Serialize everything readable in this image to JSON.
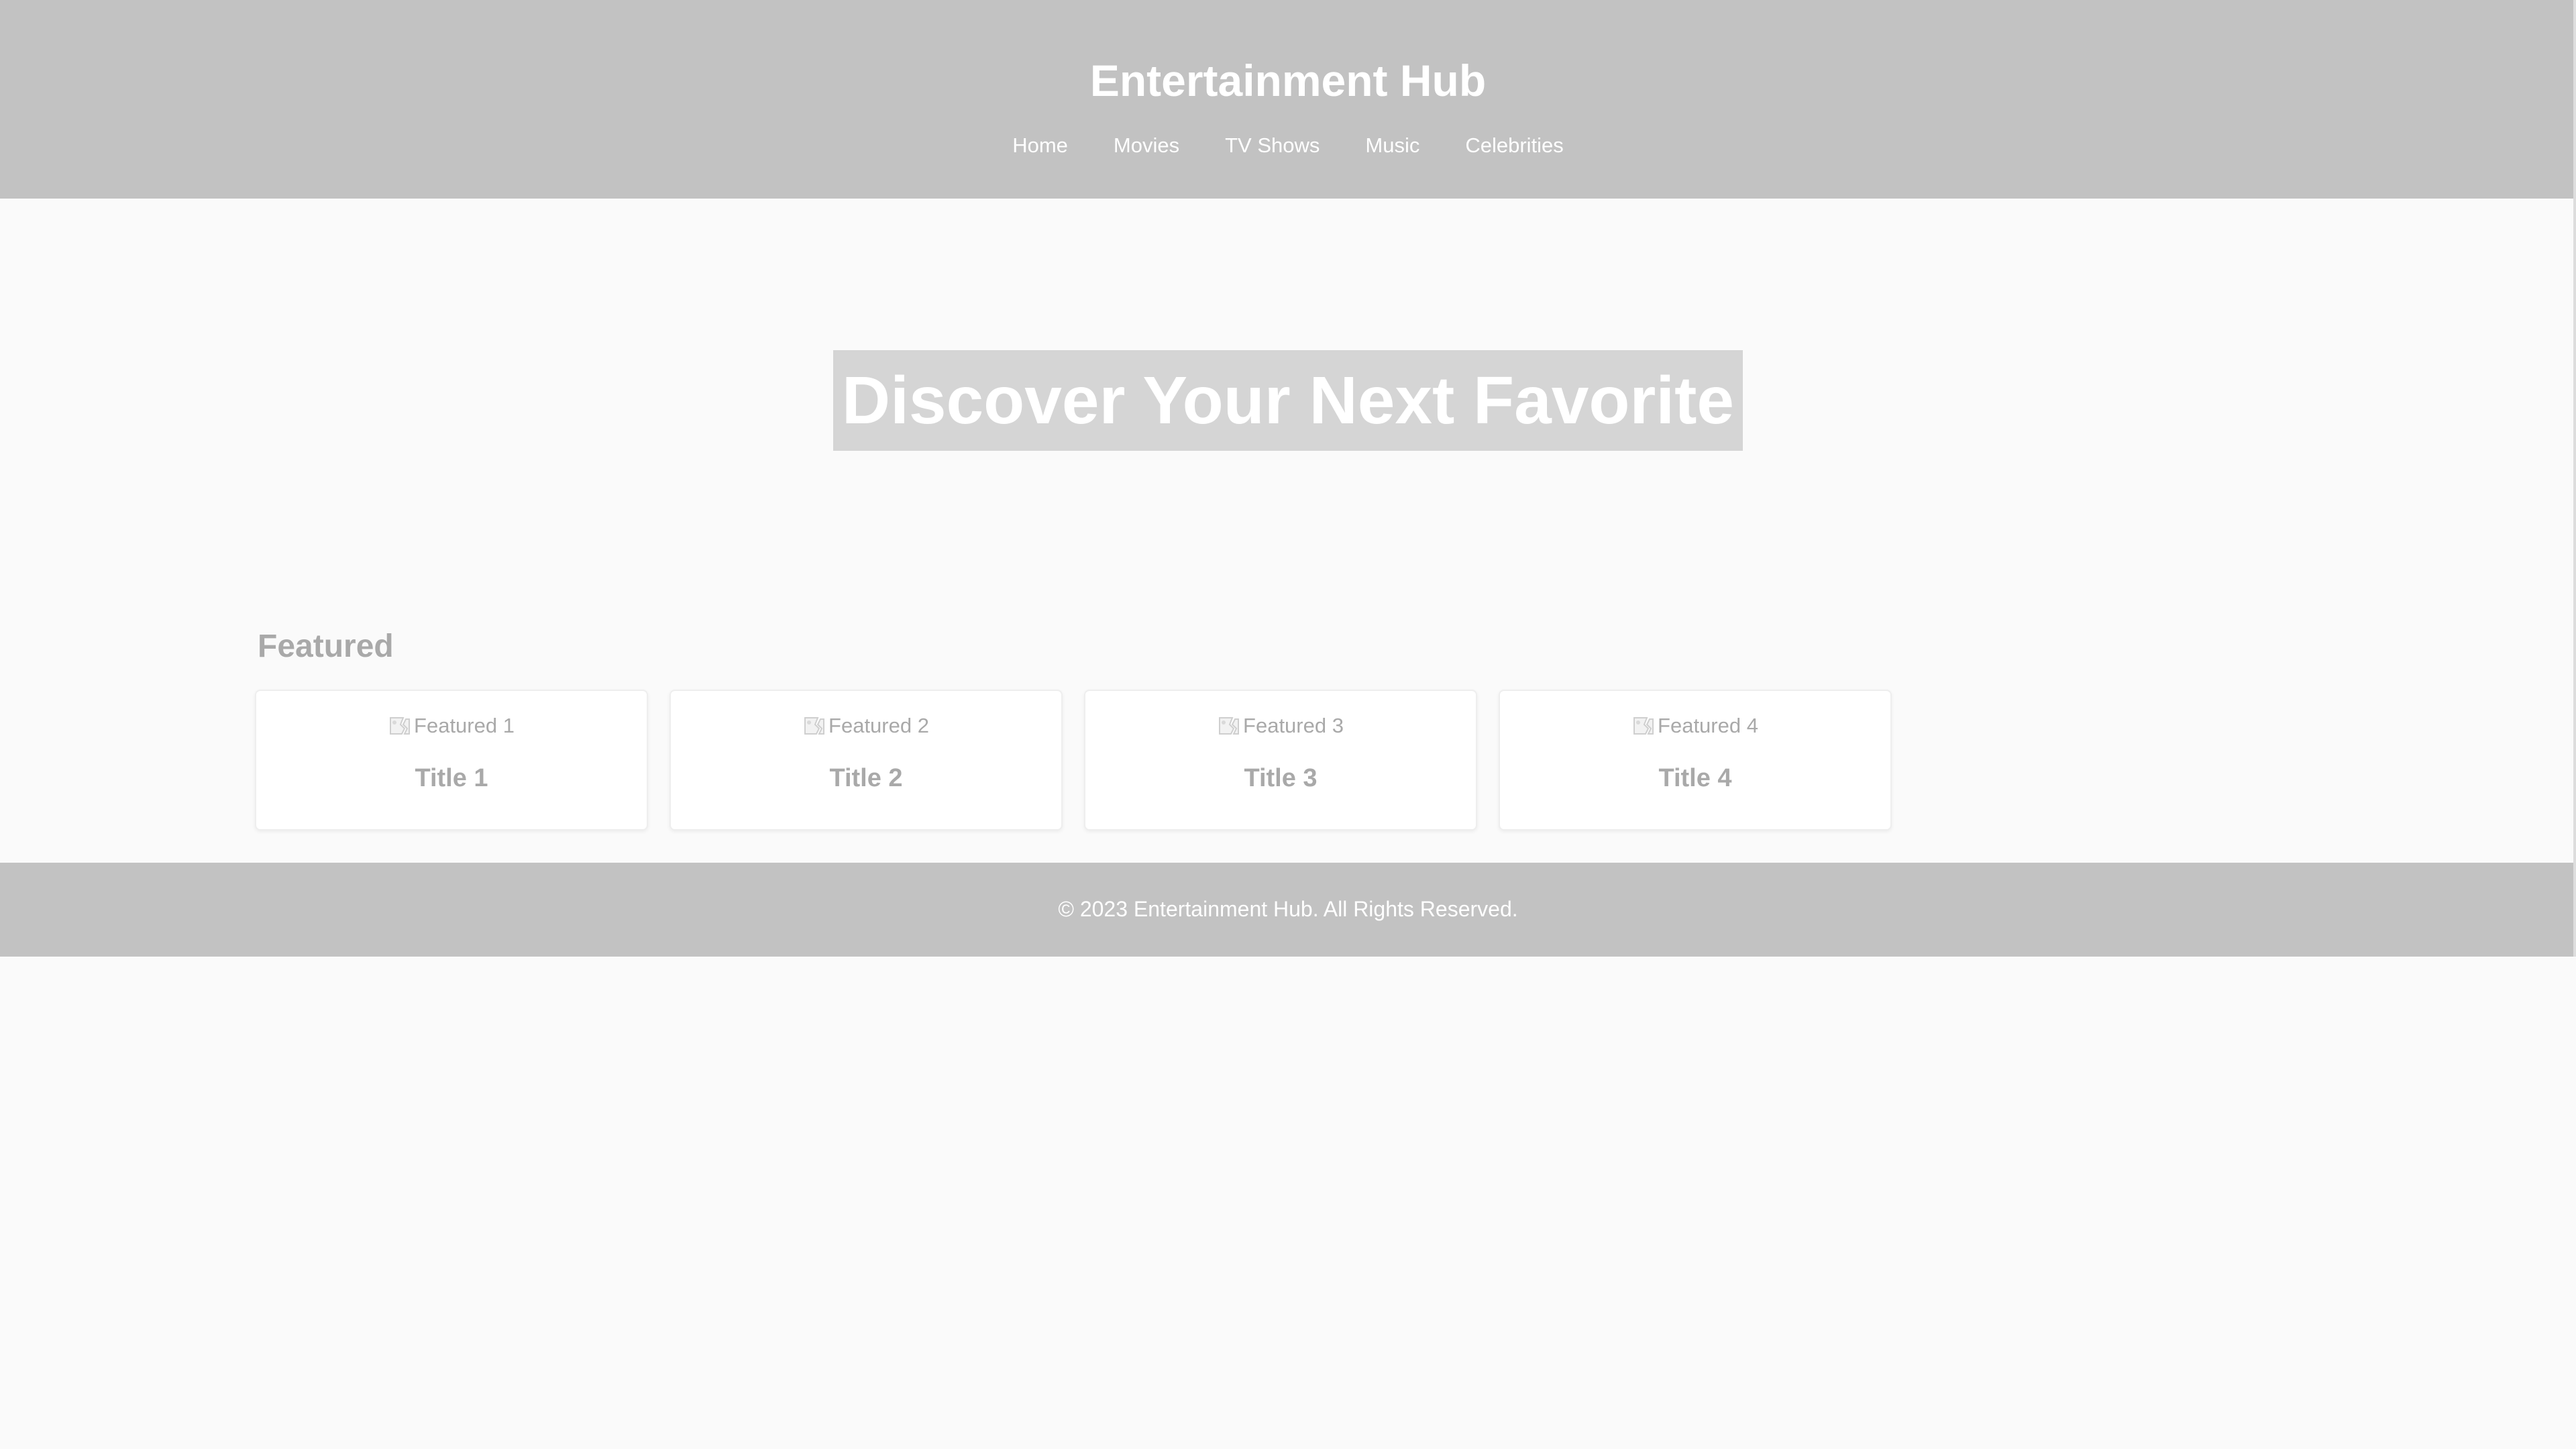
{
  "header": {
    "title": "Entertainment Hub",
    "nav": [
      {
        "label": "Home"
      },
      {
        "label": "Movies"
      },
      {
        "label": "TV Shows"
      },
      {
        "label": "Music"
      },
      {
        "label": "Celebrities"
      }
    ]
  },
  "hero": {
    "heading": "Discover Your Next Favorite"
  },
  "featured": {
    "title": "Featured",
    "cards": [
      {
        "image_alt": "Featured 1",
        "title": "Title 1",
        "icon": "broken-image-icon"
      },
      {
        "image_alt": "Featured 2",
        "title": "Title 2",
        "icon": "broken-image-icon"
      },
      {
        "image_alt": "Featured 3",
        "title": "Title 3",
        "icon": "broken-image-icon"
      },
      {
        "image_alt": "Featured 4",
        "title": "Title 4",
        "icon": "broken-image-icon"
      }
    ]
  },
  "footer": {
    "text": "© 2023 Entertainment Hub. All Rights Reserved."
  },
  "colors": {
    "header_bg": "#c2c2c2",
    "page_bg": "#fafafa",
    "hero_heading_bg": "#d5d5d5",
    "muted_text": "#a9a9a9"
  }
}
